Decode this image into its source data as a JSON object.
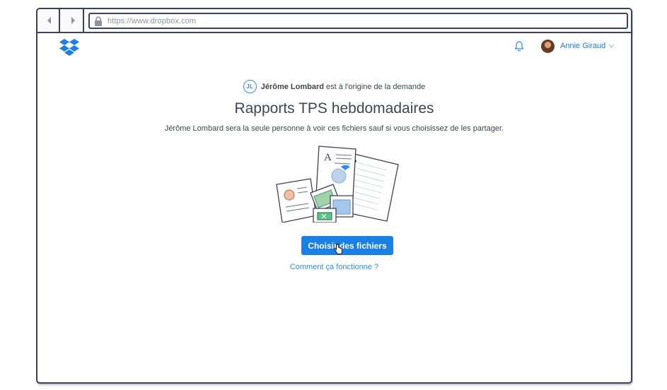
{
  "browser": {
    "url": "https://www.dropbox.com",
    "back_icon": "chevron-left-icon",
    "forward_icon": "chevron-right-icon",
    "lock_icon": "lock-icon"
  },
  "header": {
    "logo_icon": "dropbox-logo-icon",
    "notification_icon": "bell-icon",
    "user": {
      "name": "Annie Giraud",
      "dropdown_icon": "chevron-down-icon"
    }
  },
  "request": {
    "requester_initials": "JL",
    "requester_name": "Jérôme Lombard",
    "requester_suffix": "est à l'origine de la demande",
    "title": "Rapports TPS hebdomadaires",
    "description": "Jérôme Lombard sera la seule personne à voir ces fichiers sauf si vous choisissez de les partager.",
    "choose_files_label": "Choisir des fichiers",
    "help_link": "Comment ça fonctionne ?"
  },
  "colors": {
    "accent": "#1a80e3",
    "link": "#2a8ee6",
    "frame": "#3b4259",
    "text": "#3d464d"
  }
}
